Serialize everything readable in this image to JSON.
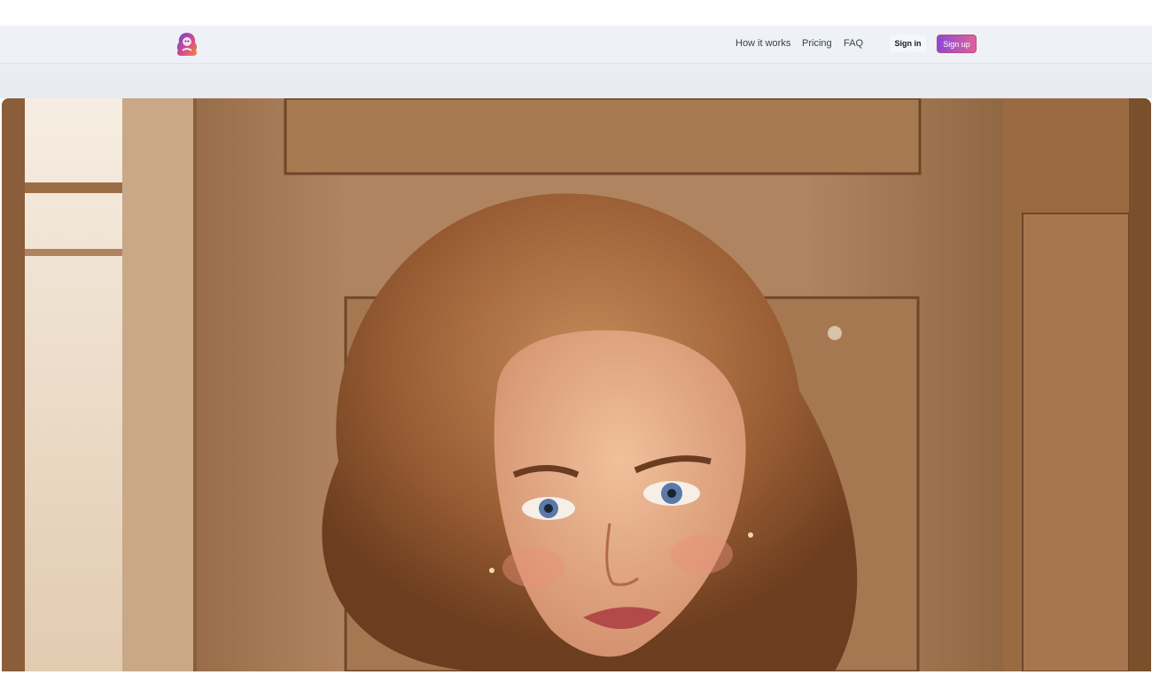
{
  "nav": {
    "logo_icon": "mascot-logo-icon",
    "links": [
      "How it works",
      "Pricing",
      "FAQ"
    ],
    "signin_label": "Sign in",
    "signup_label": "Sign up"
  },
  "colors": {
    "navbar_bg": "#eef1f6",
    "signup_gradient_start": "#8b4ad8",
    "signup_gradient_end": "#e0609a"
  },
  "hero": {
    "image": "ai-generated-portrait-illustration"
  }
}
